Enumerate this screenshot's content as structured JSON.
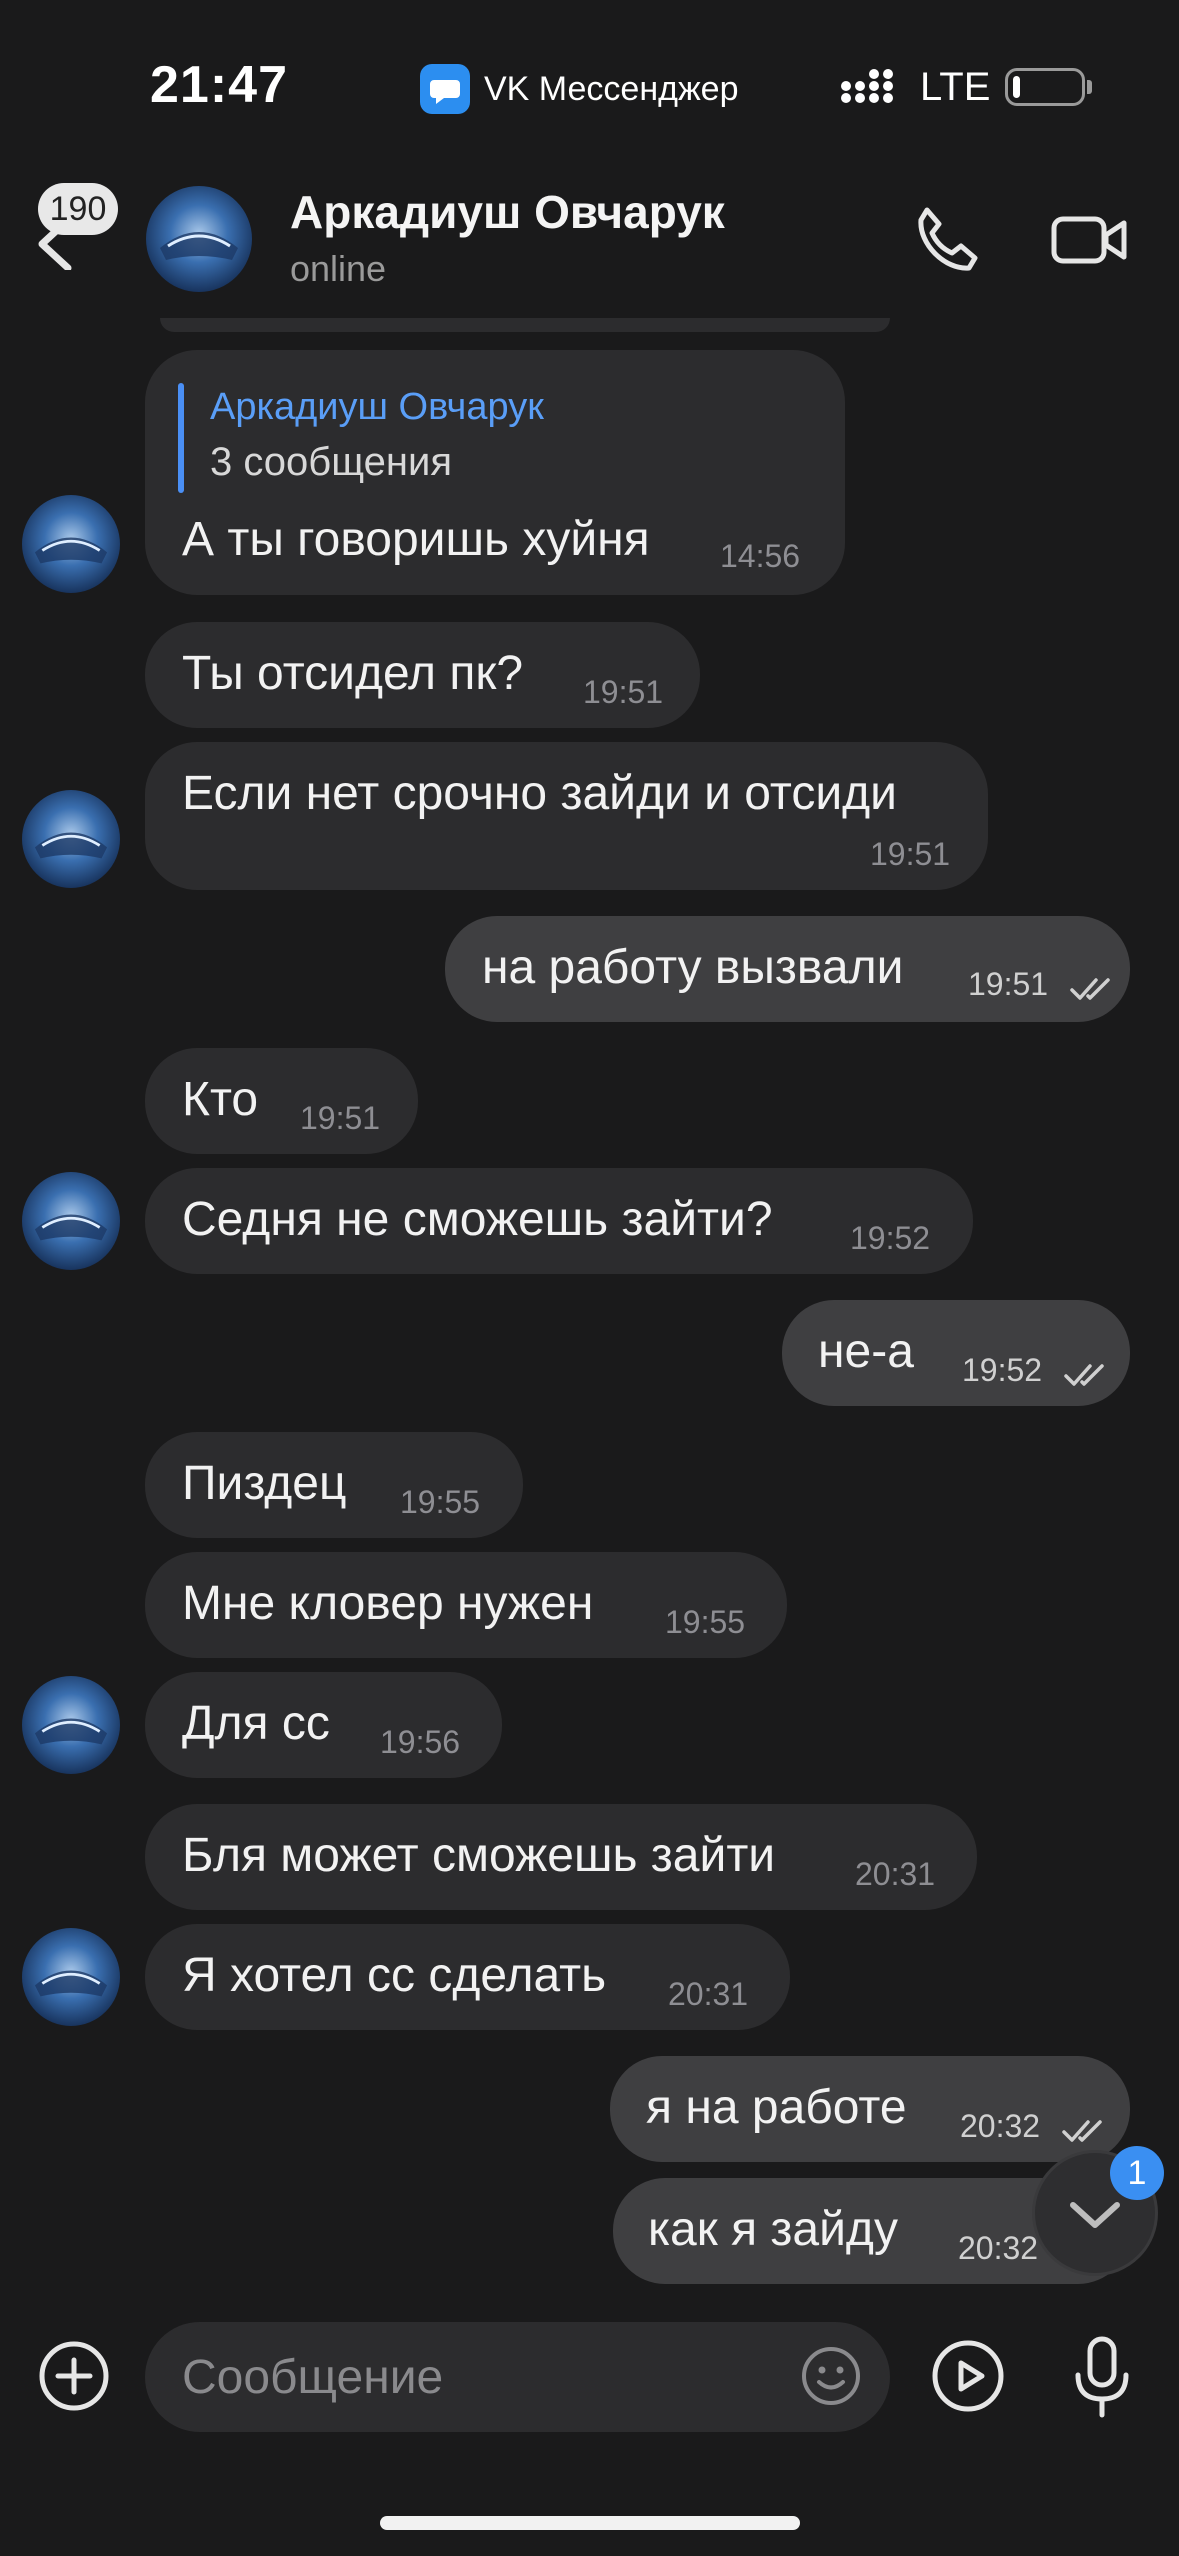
{
  "status_bar": {
    "time": "21:47",
    "app_name": "VK Мессенджер",
    "network": "LTE",
    "battery_level": 0.12
  },
  "header": {
    "back_badge": "190",
    "contact_name": "Аркадиуш Овчарук",
    "status": "online",
    "icons": [
      "back-icon",
      "phone-icon",
      "video-camera-icon"
    ]
  },
  "messages": [
    {
      "dir": "in",
      "reply_name": "Аркадиуш Овчарук",
      "reply_text": "3 сообщения",
      "text": "А ты говоришь хуйня",
      "time": "14:56"
    },
    {
      "dir": "in",
      "text": "Ты отсидел пк?",
      "time": "19:51"
    },
    {
      "dir": "in",
      "text": "Если нет срочно зайди и отсиди",
      "time": "19:51"
    },
    {
      "dir": "out",
      "text": "на работу вызвали",
      "time": "19:51"
    },
    {
      "dir": "in",
      "text": "Кто",
      "time": "19:51"
    },
    {
      "dir": "in",
      "text": "Седня не сможешь зайти?",
      "time": "19:52"
    },
    {
      "dir": "out",
      "text": "не-а",
      "time": "19:52"
    },
    {
      "dir": "in",
      "text": "Пиздец",
      "time": "19:55"
    },
    {
      "dir": "in",
      "text": "Мне кловер нужен",
      "time": "19:55"
    },
    {
      "dir": "in",
      "text": "Для сс",
      "time": "19:56"
    },
    {
      "dir": "in",
      "text": "Бля может сможешь зайти",
      "time": "20:31"
    },
    {
      "dir": "in",
      "text": "Я хотел сс сделать",
      "time": "20:31"
    },
    {
      "dir": "out",
      "text": "я на работе",
      "time": "20:32"
    },
    {
      "dir": "out",
      "text": "как я зайду",
      "time": "20:32"
    }
  ],
  "scroll_down": {
    "unread": "1"
  },
  "composer": {
    "placeholder": "Сообщение"
  },
  "colors": {
    "background": "#1a1a1b",
    "incoming": "#2c2c2e",
    "outgoing": "#3f3f41",
    "accent": "#3a8ff2"
  }
}
